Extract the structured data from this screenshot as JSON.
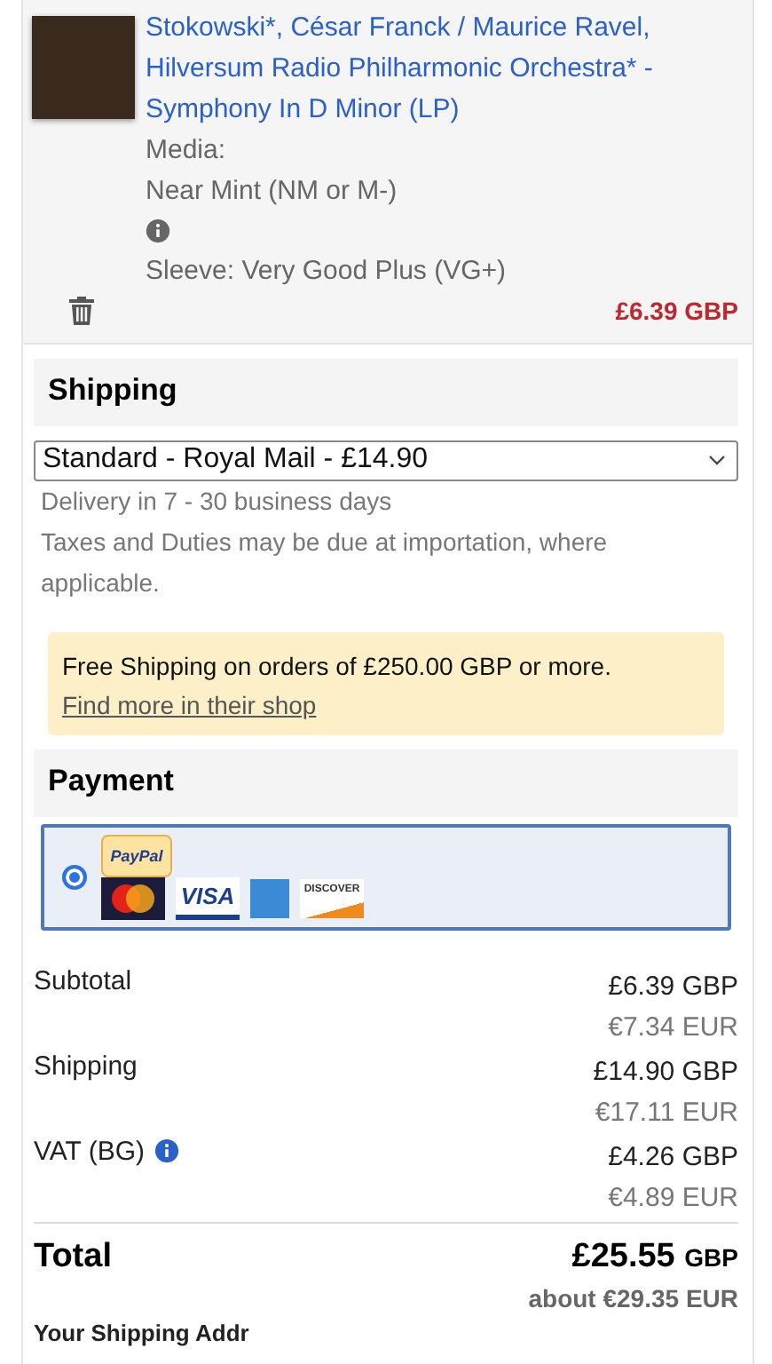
{
  "item": {
    "title": "Stokowski*, César Franck / Maurice Ravel, Hilversum Radio Philharmonic Orchestra* - Symphony In D Minor (LP)",
    "media_label": "Media:",
    "media_condition": "Near Mint (NM or M-)",
    "sleeve": "Sleeve: Very Good Plus (VG+)",
    "price": "£6.39",
    "price_currency": "GBP"
  },
  "shipping": {
    "heading": "Shipping",
    "method": "Standard - Royal Mail - £14.90",
    "delivery": "Delivery in 7 - 30 business days",
    "taxes_note": "Taxes and Duties may be due at importation, where applicable.",
    "notice": "Free Shipping on orders of £250.00 GBP or more.",
    "notice_link": "Find more in their shop"
  },
  "payment": {
    "heading": "Payment",
    "options": [
      {
        "selected": true,
        "logos": [
          {
            "kind": "paypal",
            "text": "PayPal"
          },
          {
            "kind": "mastercard"
          },
          {
            "kind": "visa",
            "text": "VISA"
          },
          {
            "kind": "amex"
          },
          {
            "kind": "discover",
            "text": "DISCOVER"
          }
        ]
      }
    ]
  },
  "summary": {
    "rows": [
      {
        "label": "Subtotal",
        "info": false,
        "amount": "£6.39 GBP",
        "converted": "€7.34 EUR"
      },
      {
        "label": "Shipping",
        "info": false,
        "amount": "£14.90 GBP",
        "converted": "€17.11 EUR"
      },
      {
        "label": "VAT (BG)",
        "info": true,
        "amount": "£4.26 GBP",
        "converted": "€4.89 EUR"
      }
    ],
    "total_label": "Total",
    "total_amount": "£25.55",
    "total_currency": "GBP",
    "total_converted": "about €29.35 EUR"
  },
  "next_heading": "Your Shipping Addr"
}
